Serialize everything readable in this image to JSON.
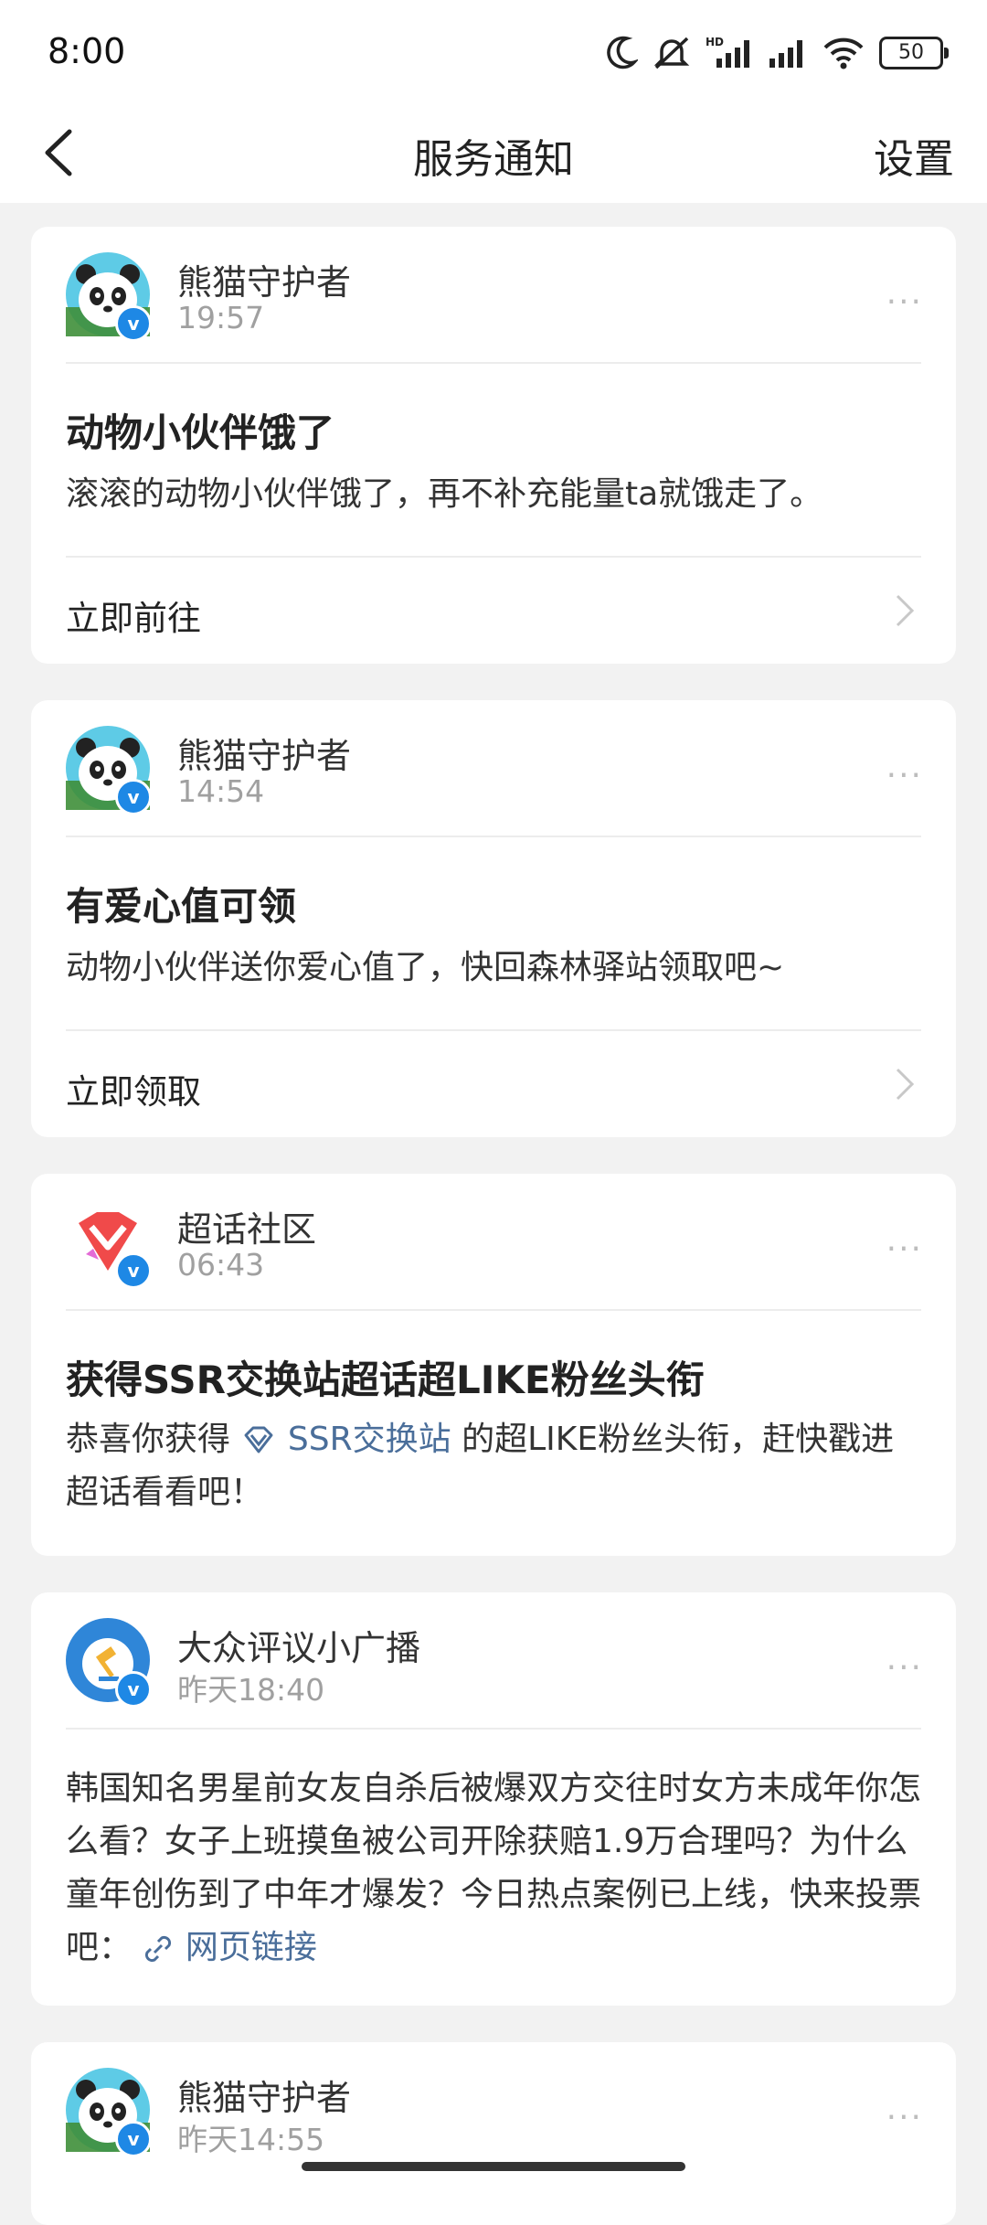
{
  "status_bar": {
    "time": "8:00",
    "battery": "50",
    "icons": [
      "moon-icon",
      "mute-icon",
      "hd-signal-icon",
      "signal-icon",
      "wifi-icon",
      "battery-icon"
    ]
  },
  "nav": {
    "title": "服务通知",
    "settings": "设置"
  },
  "colors": {
    "link": "#4a6e9a",
    "verified": "#1e88e5",
    "background": "#f2f2f2"
  },
  "notifications": [
    {
      "sender": "熊猫守护者",
      "time": "19:57",
      "title": "动物小伙伴饿了",
      "body": "滚滚的动物小伙伴饿了，再不补充能量ta就饿走了。",
      "action": "立即前往"
    },
    {
      "sender": "熊猫守护者",
      "time": "14:54",
      "title": "有爱心值可领",
      "body": "动物小伙伴送你爱心值了，快回森林驿站领取吧~",
      "action": "立即领取"
    },
    {
      "sender": "超话社区",
      "time": "06:43",
      "title": "获得SSR交换站超话超LIKE粉丝头衔",
      "body_prefix": "恭喜你获得",
      "body_link": "SSR交换站",
      "body_suffix": "的超LIKE粉丝头衔，赶快戳进超话看看吧！"
    },
    {
      "sender": "大众评议小广播",
      "time": "昨天18:40",
      "body": "韩国知名男星前女友自杀后被爆双方交往时女方未成年你怎么看？女子上班摸鱼被公司开除获赔1.9万合理吗？为什么童年创伤到了中年才爆发？今日热点案例已上线，快来投票吧：",
      "body_link": "网页链接"
    },
    {
      "sender": "熊猫守护者",
      "time": "昨天14:55"
    }
  ]
}
